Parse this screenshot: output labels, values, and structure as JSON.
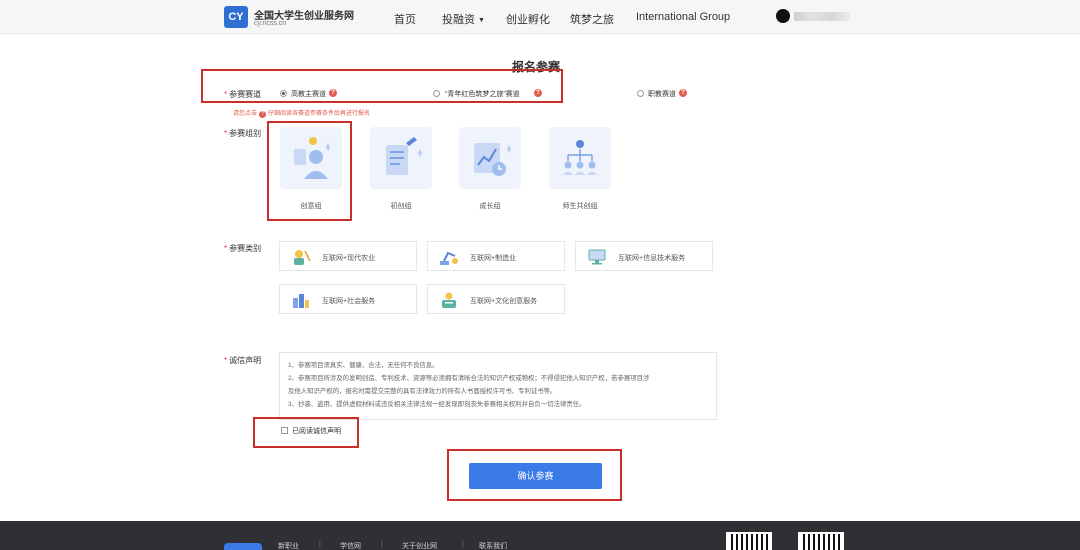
{
  "header": {
    "logo_mark": "CY",
    "site_title": "全国大学生创业服务网",
    "site_domain": "cy.ncss.cn",
    "nav": [
      {
        "label": "首页"
      },
      {
        "label": "投融资"
      },
      {
        "label": "创业孵化"
      },
      {
        "label": "筑梦之旅"
      },
      {
        "label": "International Group"
      }
    ]
  },
  "form": {
    "title": "报名参赛",
    "track": {
      "label": "参赛赛道",
      "options": [
        {
          "label": "高教主赛道",
          "selected": true
        },
        {
          "label": "“青年红色筑梦之旅”赛道",
          "selected": false
        },
        {
          "label": "职教赛道",
          "selected": false
        }
      ],
      "hint_prefix": "请您点击",
      "hint_suffix": "仔细阅读各赛道参赛条件后再进行报名"
    },
    "group": {
      "label": "参赛组别",
      "options": [
        {
          "label": "创意组",
          "selected": true
        },
        {
          "label": "初创组",
          "selected": false
        },
        {
          "label": "成长组",
          "selected": false
        },
        {
          "label": "师生共创组",
          "selected": false
        }
      ]
    },
    "category": {
      "label": "参赛类别",
      "options": [
        {
          "label": "互联网+现代农业"
        },
        {
          "label": "互联网+制造业"
        },
        {
          "label": "互联网+信息技术服务"
        },
        {
          "label": "互联网+社会服务"
        },
        {
          "label": "互联网+文化创意服务"
        }
      ]
    },
    "declaration": {
      "label": "诚信声明",
      "lines": [
        "1、参赛项目须真实、健康、合法，无任何不良信息。",
        "2、参赛项目所涉及的发明创造、专利技术、资源等必须拥有清晰合法的知识产权或物权；不得侵犯他人知识产权，若参赛项目涉",
        "及他人知识产权的，报名时需提交完整的具有法律效力的所有人书面授权许可书、专利证书等。",
        "3、抄袭、盗用、提供虚假材料或违反相关法律法规一经发现即刻丧失参赛相关权利并自负一切法律责任。"
      ],
      "checkbox_label": "已阅读诚信声明",
      "checked": false
    },
    "submit_label": "确认参赛"
  },
  "footer": {
    "links": [
      "新职业",
      "学信网",
      "关于创业网",
      "联系我们"
    ]
  },
  "colors": {
    "accent": "#3b7be8",
    "required": "#e23c3c",
    "highlight_box": "#c9302c",
    "footer_bg": "#2f3033"
  }
}
